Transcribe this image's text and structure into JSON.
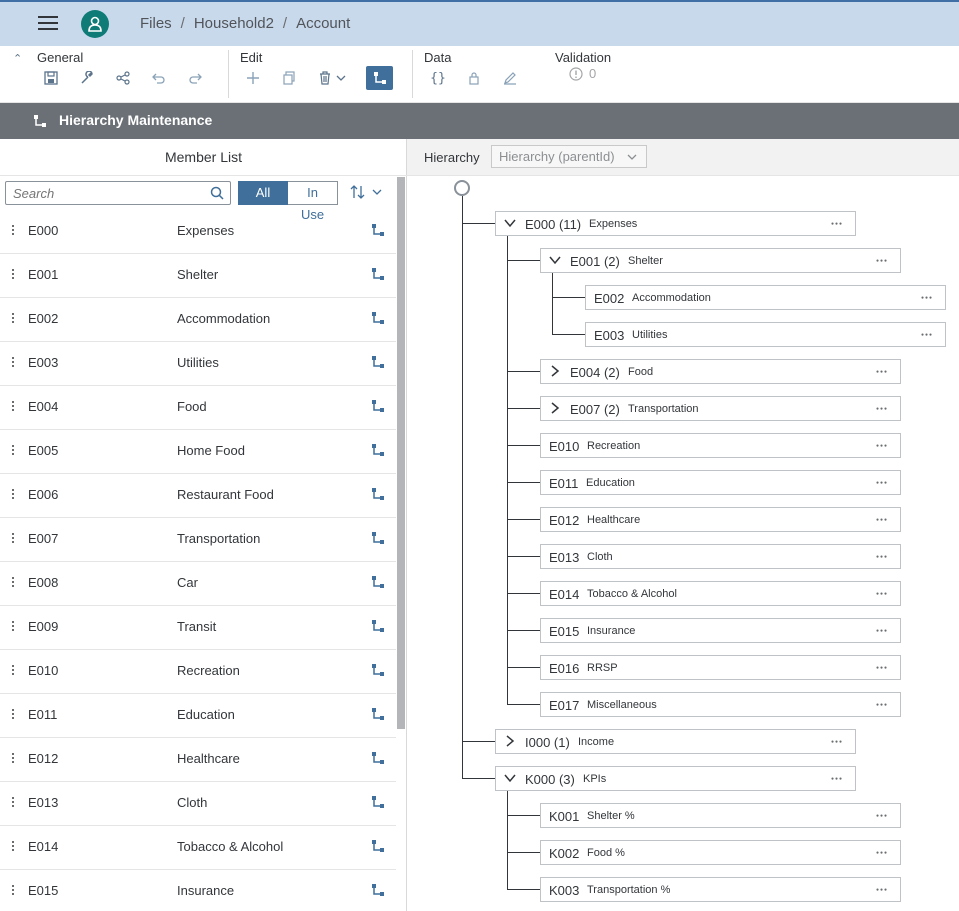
{
  "shell": {
    "breadcrumbs": [
      "Files",
      "Household2",
      "Account"
    ],
    "separator": "/"
  },
  "toolbar": {
    "general_label": "General",
    "edit_label": "Edit",
    "data_label": "Data",
    "validation_label": "Validation",
    "validation_count": "0"
  },
  "page": {
    "title": "Hierarchy Maintenance"
  },
  "member_list": {
    "title": "Member List",
    "search_placeholder": "Search",
    "filter_all": "All",
    "filter_in_use": "In Use",
    "items": [
      {
        "id": "E000",
        "name": "Expenses"
      },
      {
        "id": "E001",
        "name": "Shelter"
      },
      {
        "id": "E002",
        "name": "Accommodation"
      },
      {
        "id": "E003",
        "name": "Utilities"
      },
      {
        "id": "E004",
        "name": "Food"
      },
      {
        "id": "E005",
        "name": "Home Food"
      },
      {
        "id": "E006",
        "name": "Restaurant Food"
      },
      {
        "id": "E007",
        "name": "Transportation"
      },
      {
        "id": "E008",
        "name": "Car"
      },
      {
        "id": "E009",
        "name": "Transit"
      },
      {
        "id": "E010",
        "name": "Recreation"
      },
      {
        "id": "E011",
        "name": "Education"
      },
      {
        "id": "E012",
        "name": "Healthcare"
      },
      {
        "id": "E013",
        "name": "Cloth"
      },
      {
        "id": "E014",
        "name": "Tobacco & Alcohol"
      },
      {
        "id": "E015",
        "name": "Insurance"
      }
    ]
  },
  "hierarchy": {
    "label": "Hierarchy",
    "selector_value": "Hierarchy (parentId)",
    "nodes": [
      {
        "code": "E000 (11)",
        "desc": "Expenses",
        "expander": "open",
        "level": 1
      },
      {
        "code": "E001 (2)",
        "desc": "Shelter",
        "expander": "open",
        "level": 2
      },
      {
        "code": "E002",
        "desc": "Accommodation",
        "expander": "none",
        "level": 3
      },
      {
        "code": "E003",
        "desc": "Utilities",
        "expander": "none",
        "level": 3
      },
      {
        "code": "E004 (2)",
        "desc": "Food",
        "expander": "closed",
        "level": 2
      },
      {
        "code": "E007 (2)",
        "desc": "Transportation",
        "expander": "closed",
        "level": 2
      },
      {
        "code": "E010",
        "desc": "Recreation",
        "expander": "none",
        "level": 2
      },
      {
        "code": "E011",
        "desc": "Education",
        "expander": "none",
        "level": 2
      },
      {
        "code": "E012",
        "desc": "Healthcare",
        "expander": "none",
        "level": 2
      },
      {
        "code": "E013",
        "desc": "Cloth",
        "expander": "none",
        "level": 2
      },
      {
        "code": "E014",
        "desc": "Tobacco & Alcohol",
        "expander": "none",
        "level": 2
      },
      {
        "code": "E015",
        "desc": "Insurance",
        "expander": "none",
        "level": 2
      },
      {
        "code": "E016",
        "desc": "RRSP",
        "expander": "none",
        "level": 2
      },
      {
        "code": "E017",
        "desc": "Miscellaneous",
        "expander": "none",
        "level": 2
      },
      {
        "code": "I000 (1)",
        "desc": "Income",
        "expander": "closed",
        "level": 1
      },
      {
        "code": "K000 (3)",
        "desc": "KPIs",
        "expander": "open",
        "level": 1
      },
      {
        "code": "K001",
        "desc": "Shelter %",
        "expander": "none",
        "level": 2
      },
      {
        "code": "K002",
        "desc": "Food %",
        "expander": "none",
        "level": 2
      },
      {
        "code": "K003",
        "desc": "Transportation %",
        "expander": "none",
        "level": 2
      }
    ]
  },
  "colors": {
    "shell_bg": "#c9d9ec",
    "accent": "#3f6f9a",
    "title_bar": "#6a7076"
  }
}
